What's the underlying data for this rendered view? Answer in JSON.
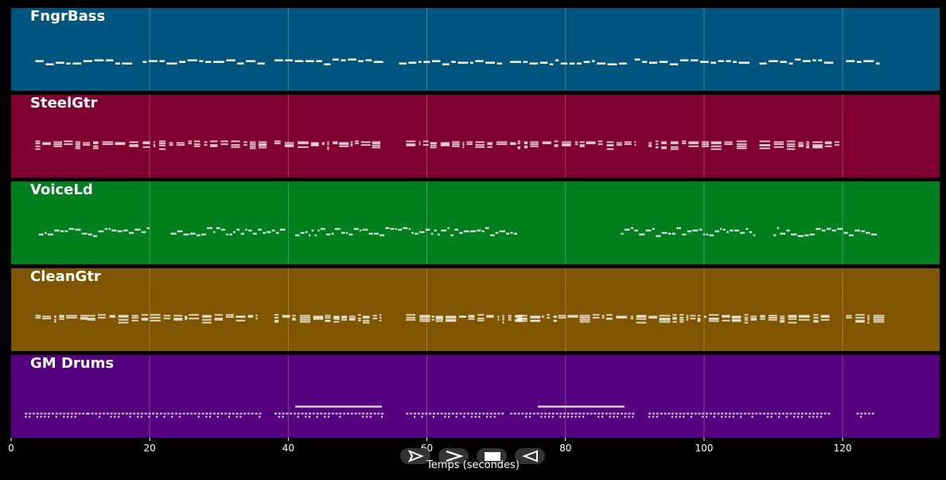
{
  "chart_data": {
    "type": "piano-roll",
    "xlabel": "Temps (secondes)",
    "xlim": [
      0,
      134
    ],
    "xticks": [
      0,
      20,
      40,
      60,
      80,
      100,
      120
    ],
    "grid": true,
    "tracks": [
      {
        "name": "FngrBass",
        "color": "#00557f",
        "segments": [
          [
            3.5,
            17.5
          ],
          [
            19,
            36
          ],
          [
            38,
            53
          ],
          [
            56,
            71
          ],
          [
            72,
            88.5
          ],
          [
            90,
            106.5
          ],
          [
            108,
            117.5
          ],
          [
            120.5,
            125.5
          ]
        ],
        "style": "bass"
      },
      {
        "name": "SteelGtr",
        "color": "#7f002f",
        "segments": [
          [
            3.5,
            17.5
          ],
          [
            19,
            36
          ],
          [
            38,
            53.5
          ],
          [
            57,
            71
          ],
          [
            72,
            90
          ],
          [
            92,
            106
          ],
          [
            108,
            119
          ]
        ],
        "style": "chords"
      },
      {
        "name": "VoiceLd",
        "color": "#007f1f",
        "segments": [
          [
            4,
            20
          ],
          [
            23,
            39
          ],
          [
            41,
            73
          ],
          [
            88,
            107.5
          ],
          [
            110,
            125
          ]
        ],
        "style": "melody"
      },
      {
        "name": "CleanGtr",
        "color": "#7f5500",
        "segments": [
          [
            3.5,
            11
          ],
          [
            11,
            36
          ],
          [
            38,
            53.5
          ],
          [
            57,
            73
          ],
          [
            73,
            91
          ],
          [
            92,
            118
          ],
          [
            120.5,
            125.5
          ]
        ],
        "style": "chords"
      },
      {
        "name": "GM Drums",
        "color": "#55007f",
        "segments": [
          [
            2,
            11
          ],
          [
            11,
            36
          ],
          [
            38,
            53.5
          ],
          [
            57,
            71
          ],
          [
            72,
            90
          ],
          [
            92,
            118
          ],
          [
            122,
            124.5
          ]
        ],
        "style": "drums"
      }
    ]
  },
  "controls": [
    {
      "name": "play-button",
      "icon": "play-outline-icon"
    },
    {
      "name": "next-button",
      "icon": "chevron-right-icon"
    },
    {
      "name": "stop-button",
      "icon": "stop-icon"
    },
    {
      "name": "rewind-button",
      "icon": "rewind-icon"
    }
  ]
}
